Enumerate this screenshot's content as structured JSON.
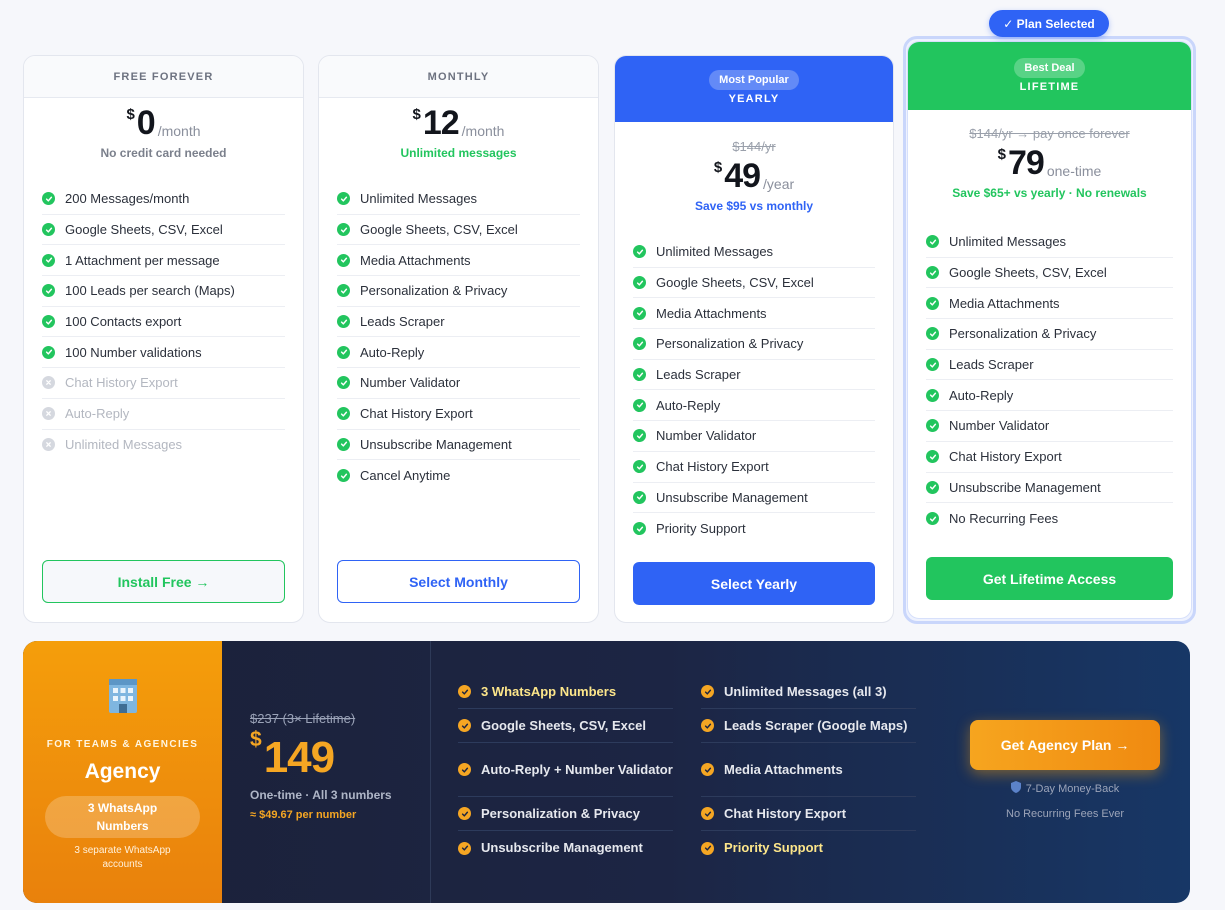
{
  "plans": {
    "free": {
      "header": "FREE FOREVER",
      "currency": "$",
      "amount": "0",
      "period": "/month",
      "note": "No credit card needed",
      "features": [
        {
          "label": "200 Messages/month",
          "included": true
        },
        {
          "label": "Google Sheets, CSV, Excel",
          "included": true
        },
        {
          "label": "1 Attachment per message",
          "included": true
        },
        {
          "label": "100 Leads per search (Maps)",
          "included": true
        },
        {
          "label": "100 Contacts export",
          "included": true
        },
        {
          "label": "100 Number validations",
          "included": true
        },
        {
          "label": "Chat History Export",
          "included": false
        },
        {
          "label": "Auto-Reply",
          "included": false
        },
        {
          "label": "Unlimited Messages",
          "included": false
        }
      ],
      "button": "Install Free →"
    },
    "monthly": {
      "header": "MONTHLY",
      "currency": "$",
      "amount": "12",
      "period": "/month",
      "note": "Unlimited messages",
      "features": [
        {
          "label": "Unlimited Messages",
          "included": true
        },
        {
          "label": "Google Sheets, CSV, Excel",
          "included": true
        },
        {
          "label": "Media Attachments",
          "included": true
        },
        {
          "label": "Personalization & Privacy",
          "included": true
        },
        {
          "label": "Leads Scraper",
          "included": true
        },
        {
          "label": "Auto-Reply",
          "included": true
        },
        {
          "label": "Number Validator",
          "included": true
        },
        {
          "label": "Chat History Export",
          "included": true
        },
        {
          "label": "Unsubscribe Management",
          "included": true
        },
        {
          "label": "Cancel Anytime",
          "included": true
        }
      ],
      "button": "Select Monthly"
    },
    "yearly": {
      "badge": "Most Popular",
      "header": "YEARLY",
      "old_price": "$144/yr",
      "currency": "$",
      "amount": "49",
      "period": "/year",
      "note": "Save $95 vs monthly",
      "features": [
        {
          "label": "Unlimited Messages",
          "included": true
        },
        {
          "label": "Google Sheets, CSV, Excel",
          "included": true
        },
        {
          "label": "Media Attachments",
          "included": true
        },
        {
          "label": "Personalization & Privacy",
          "included": true
        },
        {
          "label": "Leads Scraper",
          "included": true
        },
        {
          "label": "Auto-Reply",
          "included": true
        },
        {
          "label": "Number Validator",
          "included": true
        },
        {
          "label": "Chat History Export",
          "included": true
        },
        {
          "label": "Unsubscribe Management",
          "included": true
        },
        {
          "label": "Priority Support",
          "included": true
        }
      ],
      "button": "Select Yearly"
    },
    "lifetime": {
      "selected_tag": "✓ Plan Selected",
      "badge": "Best Deal",
      "header": "LIFETIME",
      "old_price": "$144/yr → pay once forever",
      "currency": "$",
      "amount": "79",
      "period": "one-time",
      "note": "Save $65+ vs yearly · No renewals",
      "features": [
        {
          "label": "Unlimited Messages",
          "included": true
        },
        {
          "label": "Google Sheets, CSV, Excel",
          "included": true
        },
        {
          "label": "Media Attachments",
          "included": true
        },
        {
          "label": "Personalization & Privacy",
          "included": true
        },
        {
          "label": "Leads Scraper",
          "included": true
        },
        {
          "label": "Auto-Reply",
          "included": true
        },
        {
          "label": "Number Validator",
          "included": true
        },
        {
          "label": "Chat History Export",
          "included": true
        },
        {
          "label": "Unsubscribe Management",
          "included": true
        },
        {
          "label": "No Recurring Fees",
          "included": true
        }
      ],
      "button": "Get Lifetime Access"
    }
  },
  "agency": {
    "icon": "office-building-icon",
    "eyebrow": "FOR TEAMS & AGENCIES",
    "title": "Agency",
    "numbers_pill": "3 WhatsApp Numbers",
    "numbers_note": "3 separate WhatsApp accounts",
    "old_price": "$237 (3× Lifetime)",
    "currency": "$",
    "amount": "149",
    "price_note": "One-time · All 3 numbers",
    "per_number": "≈ $49.67 per number",
    "features_left": [
      {
        "label": "3 WhatsApp Numbers",
        "highlight": true
      },
      {
        "label": "Google Sheets, CSV, Excel",
        "highlight": false
      },
      {
        "label": "Auto-Reply + Number Validator",
        "highlight": false
      },
      {
        "label": "Personalization & Privacy",
        "highlight": false
      },
      {
        "label": "Unsubscribe Management",
        "highlight": false
      }
    ],
    "features_right": [
      {
        "label": "Unlimited Messages (all 3)",
        "highlight": false
      },
      {
        "label": "Leads Scraper (Google Maps)",
        "highlight": false
      },
      {
        "label": "Media Attachments",
        "highlight": false
      },
      {
        "label": "Chat History Export",
        "highlight": false
      },
      {
        "label": "Priority Support",
        "highlight": true
      }
    ],
    "button": "Get Agency Plan →",
    "guarantee_icon": "shield-icon",
    "guarantee": "7-Day Money-Back",
    "no_fees": "No Recurring Fees Ever"
  },
  "colors": {
    "green": "#22c55e",
    "blue": "#2f63f5",
    "orange": "#f5a623",
    "navy": "#1c2440",
    "highlight_yellow": "#fde68a"
  }
}
